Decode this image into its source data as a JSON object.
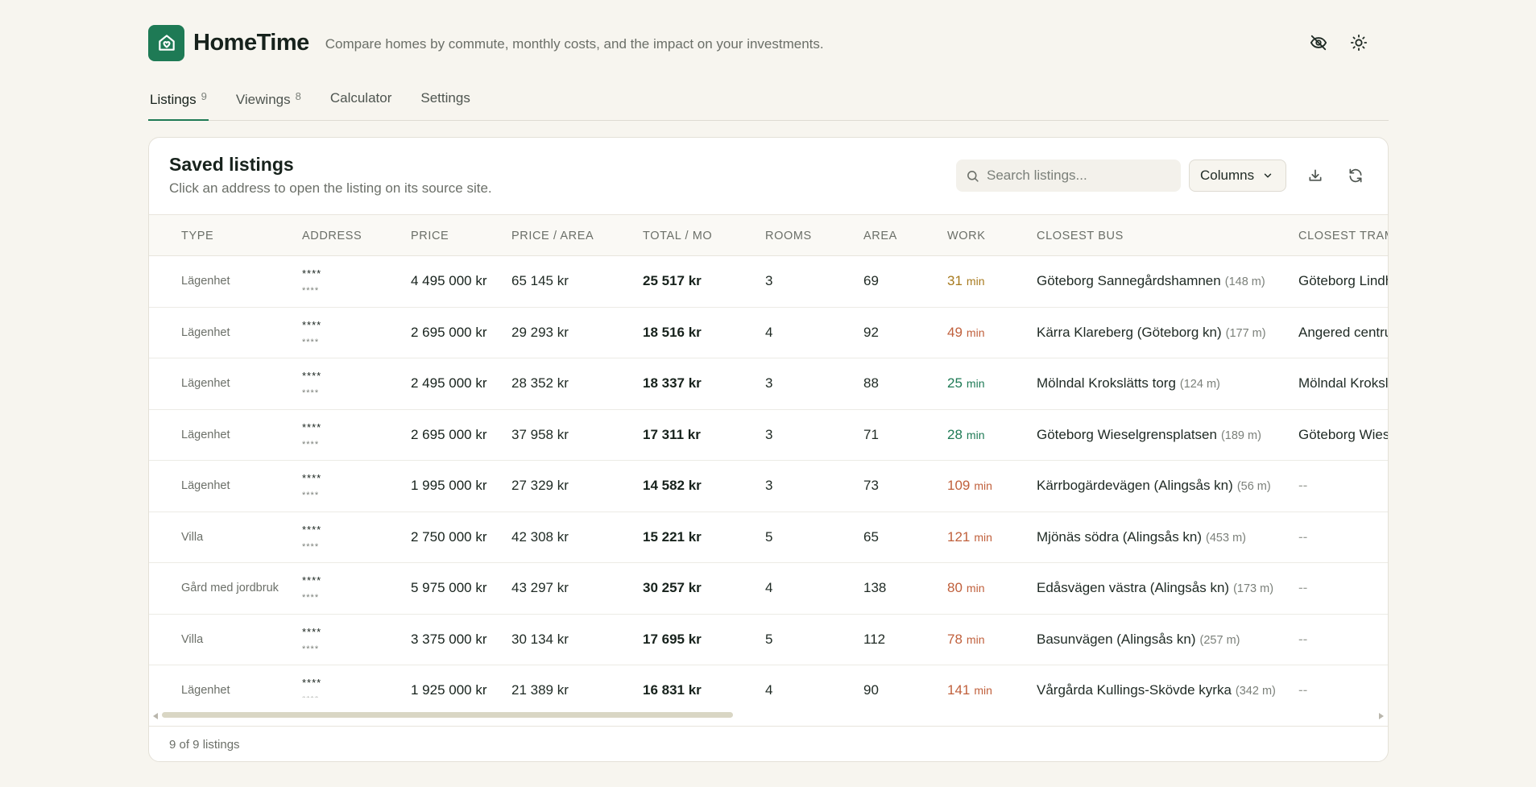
{
  "app": {
    "name": "HomeTime",
    "tagline": "Compare homes by commute, monthly costs, and the impact on your investments.",
    "accent": "#1e7a55",
    "icons": [
      "home-heart-icon",
      "eye-off-icon",
      "sun-icon"
    ]
  },
  "tabs": [
    {
      "label": "Listings",
      "count": "9",
      "active": true
    },
    {
      "label": "Viewings",
      "count": "8",
      "active": false
    },
    {
      "label": "Calculator",
      "count": "",
      "active": false
    },
    {
      "label": "Settings",
      "count": "",
      "active": false
    }
  ],
  "card": {
    "title": "Saved listings",
    "subtitle": "Click an address to open the listing on its source site.",
    "search_placeholder": "Search listings...",
    "columns_label": "Columns",
    "footer": "9 of 9 listings"
  },
  "table": {
    "columns": [
      "TYPE",
      "ADDRESS",
      "PRICE",
      "PRICE / AREA",
      "TOTAL / MO",
      "ROOMS",
      "AREA",
      "WORK",
      "CLOSEST BUS",
      "CLOSEST TRAM"
    ],
    "work_unit": "min",
    "rows": [
      {
        "type": "Lägenhet",
        "addr": "****",
        "addr_sub": "****",
        "price": "4 495 000 kr",
        "ppa": "65 145 kr",
        "total": "25 517 kr",
        "rooms": "3",
        "area": "69",
        "work": "31",
        "work_color": "#a77a1e",
        "bus": "Göteborg Sannegårdshamnen",
        "bus_dist": "(148 m)",
        "tram": "Göteborg Lindholmen"
      },
      {
        "type": "Lägenhet",
        "addr": "****",
        "addr_sub": "****",
        "price": "2 695 000 kr",
        "ppa": "29 293 kr",
        "total": "18 516 kr",
        "rooms": "4",
        "area": "92",
        "work": "49",
        "work_color": "#c0603c",
        "bus": "Kärra Klareberg (Göteborg kn)",
        "bus_dist": "(177 m)",
        "tram": "Angered centrum"
      },
      {
        "type": "Lägenhet",
        "addr": "****",
        "addr_sub": "****",
        "price": "2 495 000 kr",
        "ppa": "28 352 kr",
        "total": "18 337 kr",
        "rooms": "3",
        "area": "88",
        "work": "25",
        "work_color": "#1e7a55",
        "bus": "Mölndal Krokslätts torg",
        "bus_dist": "(124 m)",
        "tram": "Mölndal Krokslätts torg"
      },
      {
        "type": "Lägenhet",
        "addr": "****",
        "addr_sub": "****",
        "price": "2 695 000 kr",
        "ppa": "37 958 kr",
        "total": "17 311 kr",
        "rooms": "3",
        "area": "71",
        "work": "28",
        "work_color": "#1e7a55",
        "bus": "Göteborg Wieselgrensplatsen",
        "bus_dist": "(189 m)",
        "tram": "Göteborg Wieselgrensplatsen"
      },
      {
        "type": "Lägenhet",
        "addr": "****",
        "addr_sub": "****",
        "price": "1 995 000 kr",
        "ppa": "27 329 kr",
        "total": "14 582 kr",
        "rooms": "3",
        "area": "73",
        "work": "109",
        "work_color": "#c0603c",
        "bus": "Kärrbogärdevägen (Alingsås kn)",
        "bus_dist": "(56 m)",
        "tram": "--"
      },
      {
        "type": "Villa",
        "addr": "****",
        "addr_sub": "****",
        "price": "2 750 000 kr",
        "ppa": "42 308 kr",
        "total": "15 221 kr",
        "rooms": "5",
        "area": "65",
        "work": "121",
        "work_color": "#c0603c",
        "bus": "Mjönäs södra (Alingsås kn)",
        "bus_dist": "(453 m)",
        "tram": "--"
      },
      {
        "type": "Gård med jordbruk",
        "addr": "****",
        "addr_sub": "****",
        "price": "5 975 000 kr",
        "ppa": "43 297 kr",
        "total": "30 257 kr",
        "rooms": "4",
        "area": "138",
        "work": "80",
        "work_color": "#c0603c",
        "bus": "Edåsvägen västra (Alingsås kn)",
        "bus_dist": "(173 m)",
        "tram": "--"
      },
      {
        "type": "Villa",
        "addr": "****",
        "addr_sub": "****",
        "price": "3 375 000 kr",
        "ppa": "30 134 kr",
        "total": "17 695 kr",
        "rooms": "5",
        "area": "112",
        "work": "78",
        "work_color": "#c0603c",
        "bus": "Basunvägen (Alingsås kn)",
        "bus_dist": "(257 m)",
        "tram": "--"
      },
      {
        "type": "Lägenhet",
        "addr": "****",
        "addr_sub": "****",
        "price": "1 925 000 kr",
        "ppa": "21 389 kr",
        "total": "16 831 kr",
        "rooms": "4",
        "area": "90",
        "work": "141",
        "work_color": "#c0603c",
        "bus": "Vårgårda Kullings-Skövde kyrka",
        "bus_dist": "(342 m)",
        "tram": "--"
      }
    ]
  }
}
